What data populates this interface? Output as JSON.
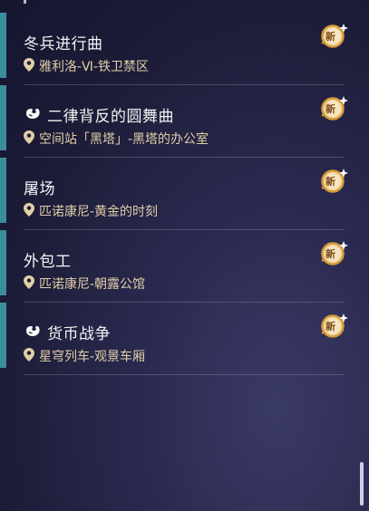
{
  "missions": [
    {
      "title": "冬兵进行曲",
      "location": "雅利洛-Ⅵ-铁卫禁区",
      "has_puzzle_icon": false,
      "badge": "新"
    },
    {
      "title": "二律背反的圆舞曲",
      "location": "空间站「黑塔」-黑塔的办公室",
      "has_puzzle_icon": true,
      "badge": "新"
    },
    {
      "title": "屠场",
      "location": "匹诺康尼-黄金的时刻",
      "has_puzzle_icon": false,
      "badge": "新"
    },
    {
      "title": "外包工",
      "location": "匹诺康尼-朝露公馆",
      "has_puzzle_icon": false,
      "badge": "新"
    },
    {
      "title": "货币战争",
      "location": "星穹列车-观景车厢",
      "has_puzzle_icon": true,
      "badge": "新"
    }
  ],
  "colors": {
    "accent": "#3c8d9c",
    "location_text": "#e2cfa6",
    "badge_gold": "#d99a3a"
  }
}
